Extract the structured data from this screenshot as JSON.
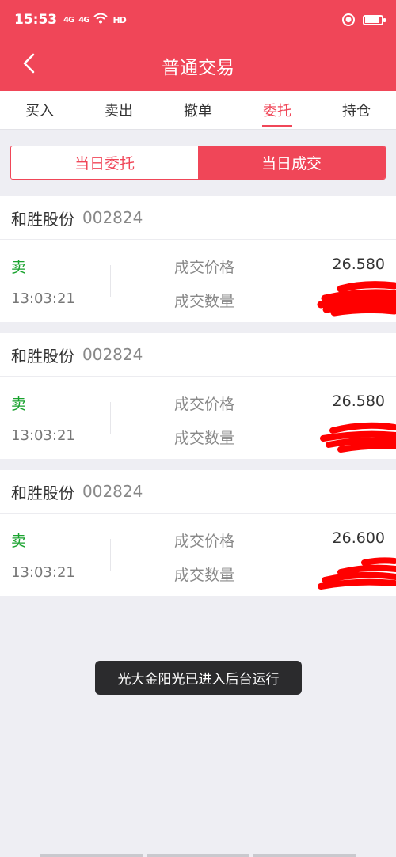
{
  "status": {
    "time": "15:53",
    "signal1": "4G",
    "signal2": "4G",
    "hd": "HD"
  },
  "header": {
    "title": "普通交易"
  },
  "tabs": [
    {
      "label": "买入"
    },
    {
      "label": "卖出"
    },
    {
      "label": "撤单"
    },
    {
      "label": "委托"
    },
    {
      "label": "持仓"
    }
  ],
  "segment": {
    "today_orders": "当日委托",
    "today_deals": "当日成交"
  },
  "trades": [
    {
      "name": "和胜股份",
      "code": "002824",
      "side": "卖",
      "time": "13:03:21",
      "price_label": "成交价格",
      "qty_label": "成交数量",
      "price": "26.580"
    },
    {
      "name": "和胜股份",
      "code": "002824",
      "side": "卖",
      "time": "13:03:21",
      "price_label": "成交价格",
      "qty_label": "成交数量",
      "price": "26.580"
    },
    {
      "name": "和胜股份",
      "code": "002824",
      "side": "卖",
      "time": "13:03:21",
      "price_label": "成交价格",
      "qty_label": "成交数量",
      "price": "26.600"
    }
  ],
  "toast": {
    "text": "光大金阳光已进入后台运行"
  },
  "colors": {
    "brand": "#f04658",
    "sell": "#1aa32f",
    "redaction": "#ff0000"
  }
}
